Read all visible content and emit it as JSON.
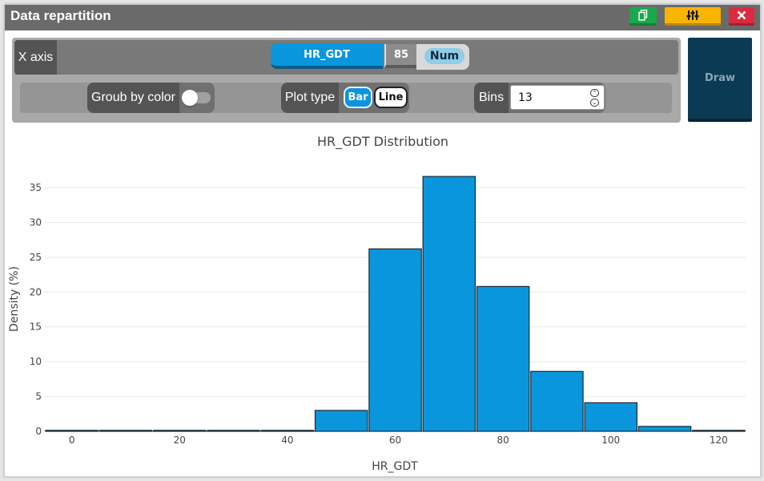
{
  "window": {
    "title": "Data repartition"
  },
  "titlebar_buttons": [
    {
      "name": "copy",
      "icon": "copy-icon",
      "color": "#1aa84a"
    },
    {
      "name": "settings",
      "icon": "sliders-icon",
      "color": "#f7b500"
    },
    {
      "name": "close",
      "icon": "close-icon",
      "color": "#dc2a3e"
    }
  ],
  "x_axis": {
    "label": "X axis",
    "variable": "HR_GDT",
    "count": "85",
    "type": "Num"
  },
  "options": {
    "group_by_color": {
      "label": "Groub by color",
      "enabled": false
    },
    "plot_type": {
      "label": "Plot type",
      "options": [
        "Bar",
        "Line"
      ],
      "selected": "Bar"
    },
    "bins": {
      "label": "Bins",
      "value": "13"
    }
  },
  "draw_button": {
    "label": "Draw"
  },
  "colors": {
    "bar": "#0a96dc",
    "accent": "#0a96dc",
    "draw": "#0b3a55"
  },
  "chart_data": {
    "type": "bar",
    "title": "HR_GDT Distribution",
    "xlabel": "HR_GDT",
    "ylabel": "Density (%)",
    "bin_edges": [
      -5,
      5,
      15,
      25,
      35,
      45,
      55,
      65,
      75,
      85,
      95,
      105,
      115,
      125
    ],
    "values": [
      0,
      0,
      0,
      0,
      0,
      3,
      26.2,
      36.6,
      20.8,
      8.6,
      4.1,
      0.7,
      0
    ],
    "xlim": [
      -5,
      125
    ],
    "ylim": [
      0,
      38
    ],
    "xticks": [
      "0",
      "20",
      "40",
      "60",
      "80",
      "100",
      "120"
    ],
    "yticks": [
      "0",
      "5",
      "10",
      "15",
      "20",
      "25",
      "30",
      "35"
    ],
    "grid": true
  }
}
